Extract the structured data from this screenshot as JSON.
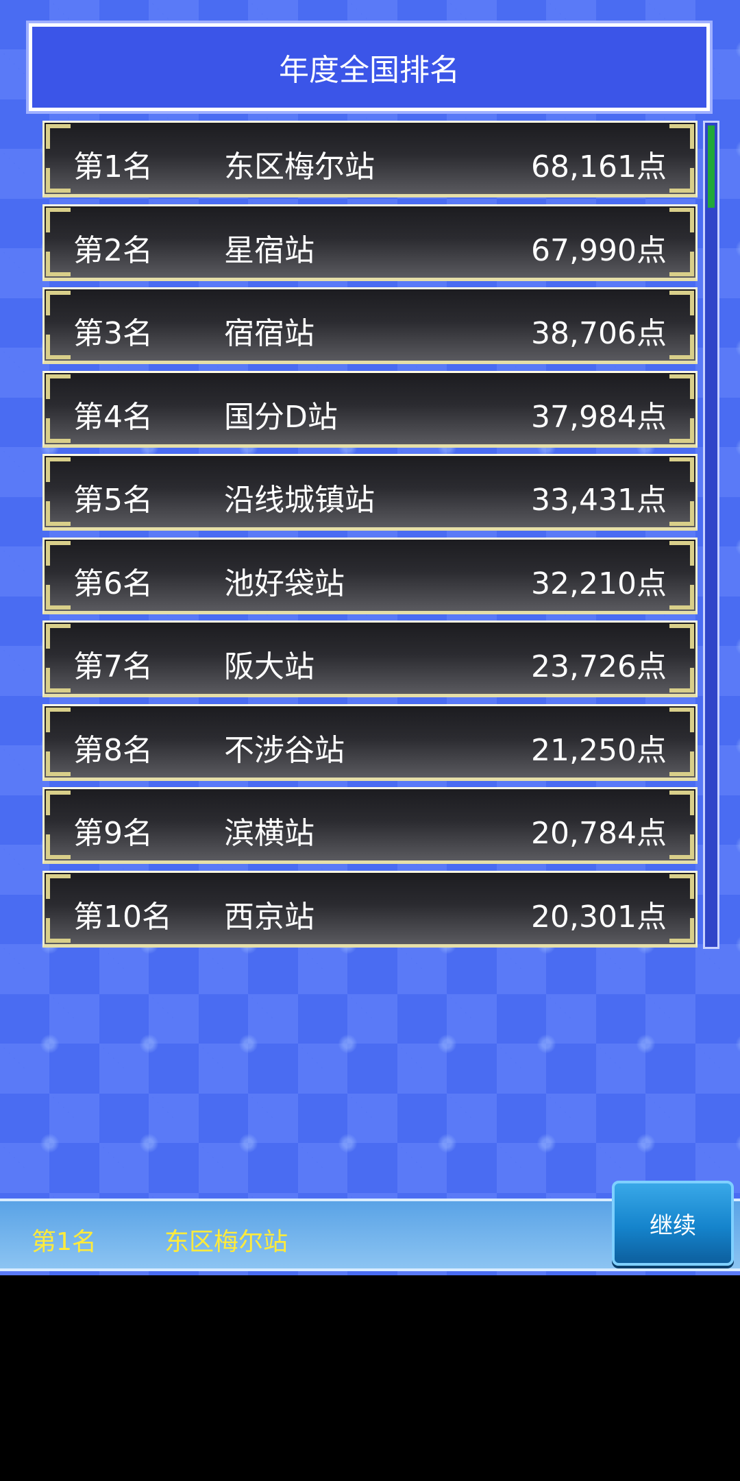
{
  "title": "年度全国排名",
  "rankings": [
    {
      "rank": "第1名",
      "name": "东区梅尔站",
      "score": "68,161点"
    },
    {
      "rank": "第2名",
      "name": "星宿站",
      "score": "67,990点"
    },
    {
      "rank": "第3名",
      "name": "宿宿站",
      "score": "38,706点"
    },
    {
      "rank": "第4名",
      "name": "国分D站",
      "score": "37,984点"
    },
    {
      "rank": "第5名",
      "name": "沿线城镇站",
      "score": "33,431点"
    },
    {
      "rank": "第6名",
      "name": "池好袋站",
      "score": "32,210点"
    },
    {
      "rank": "第7名",
      "name": "阪大站",
      "score": "23,726点"
    },
    {
      "rank": "第8名",
      "name": "不涉谷站",
      "score": "21,250点"
    },
    {
      "rank": "第9名",
      "name": "滨横站",
      "score": "20,784点"
    },
    {
      "rank": "第10名",
      "name": "西京站",
      "score": "20,301点"
    }
  ],
  "selected": {
    "rank": "第1名",
    "name": "东区梅尔站"
  },
  "continue_label": "继续",
  "colors": {
    "title_bg": "#3b55e8",
    "row_border": "#f4f0cf",
    "info_text": "#ffeb3b",
    "button": "#1584cc"
  }
}
